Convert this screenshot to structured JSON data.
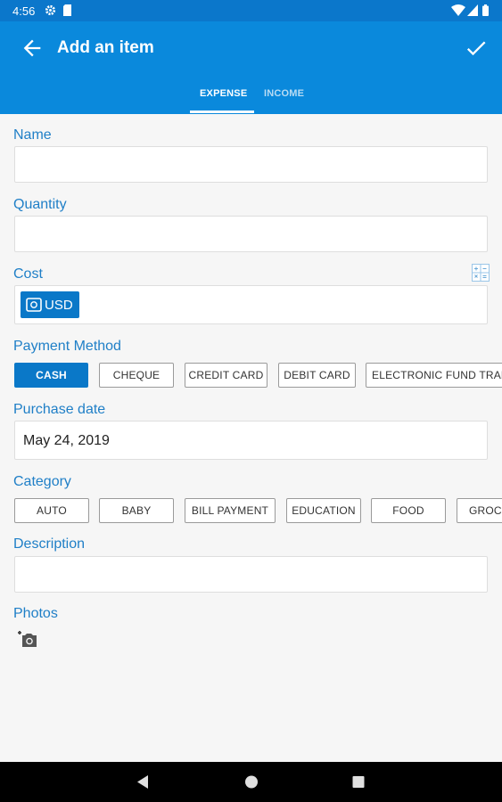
{
  "status_bar": {
    "time": "4:56"
  },
  "app_bar": {
    "title": "Add an item"
  },
  "tabs": [
    {
      "label": "EXPENSE"
    },
    {
      "label": "INCOME"
    }
  ],
  "form": {
    "name": {
      "label": "Name",
      "value": ""
    },
    "quantity": {
      "label": "Quantity",
      "value": ""
    },
    "cost": {
      "label": "Cost",
      "currency": "USD",
      "value": ""
    },
    "payment_method": {
      "label": "Payment Method",
      "options": [
        "CASH",
        "CHEQUE",
        "CREDIT CARD",
        "DEBIT CARD",
        "ELECTRONIC FUND TRAN"
      ],
      "selected": "CASH"
    },
    "purchase_date": {
      "label": "Purchase date",
      "value": "May 24, 2019"
    },
    "category": {
      "label": "Category",
      "options": [
        "AUTO",
        "BABY",
        "BILL PAYMENT",
        "EDUCATION",
        "FOOD",
        "GROCE"
      ]
    },
    "description": {
      "label": "Description",
      "value": ""
    },
    "photos": {
      "label": "Photos"
    }
  },
  "colors": {
    "app_bar": "#0a89dc",
    "status_bar": "#0b77cb",
    "accent": "#0a78c8",
    "label": "#1f7fc7"
  }
}
